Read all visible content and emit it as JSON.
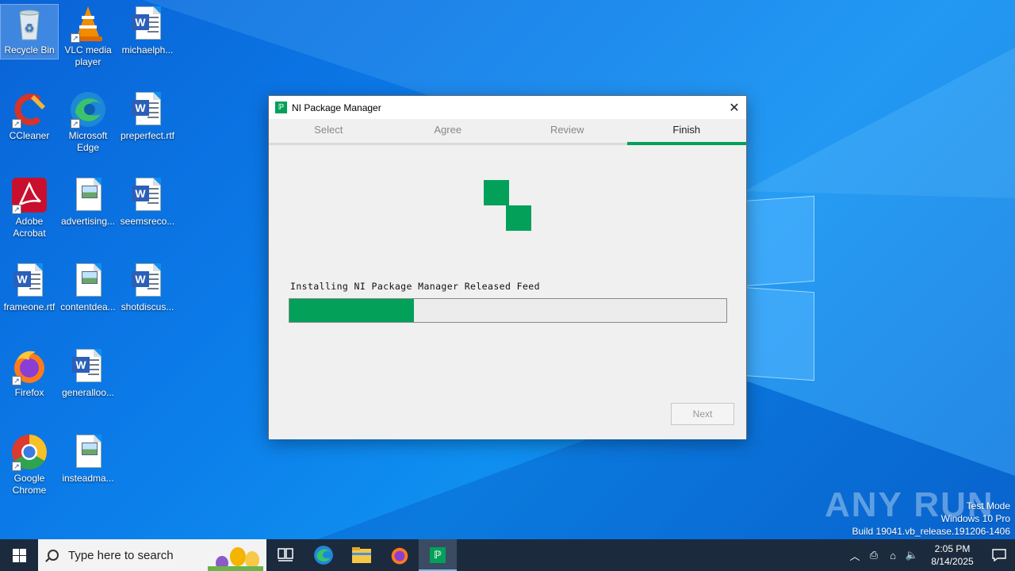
{
  "desktop": {
    "icons": [
      {
        "label": "Recycle Bin"
      },
      {
        "label": "VLC media player"
      },
      {
        "label": "michaelph..."
      },
      {
        "label": "CCleaner"
      },
      {
        "label": "Microsoft Edge"
      },
      {
        "label": "preperfect.rtf"
      },
      {
        "label": "Adobe Acrobat"
      },
      {
        "label": "advertising..."
      },
      {
        "label": "seemsreco..."
      },
      {
        "label": "frameone.rtf"
      },
      {
        "label": "contentdea..."
      },
      {
        "label": "shotdiscus..."
      },
      {
        "label": "Firefox"
      },
      {
        "label": "generalloo..."
      },
      {
        "label": "Google Chrome"
      },
      {
        "label": "insteadma..."
      }
    ]
  },
  "dialog": {
    "title": "NI Package Manager",
    "app_icon_glyph": "ℙ",
    "close_glyph": "✕",
    "tabs": [
      {
        "label": "Select"
      },
      {
        "label": "Agree"
      },
      {
        "label": "Review"
      },
      {
        "label": "Finish"
      }
    ],
    "active_tab": "Finish",
    "status_text": "Installing NI Package Manager Released Feed",
    "progress_fraction": 0.285,
    "next_label": "Next",
    "accent_color": "#03a05a"
  },
  "taskbar": {
    "search_placeholder": "Type here to search",
    "time": "2:05 PM",
    "date": "8/14/2025"
  },
  "watermark": {
    "line1": "Test Mode",
    "line2": "Windows 10 Pro",
    "line3": "Build 19041.vb_release.191206-1406",
    "brand": "ANY RUN"
  }
}
